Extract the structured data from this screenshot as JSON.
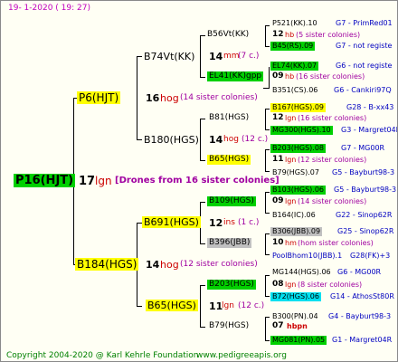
{
  "header": {
    "date": "19-   1-2020  ( 19:  27)"
  },
  "watermark": "",
  "footer": {
    "copyright": "Copyright 2004-2020 @ Karl Kehrle Foundation",
    "site": "www.pedigreeapis.org"
  },
  "root": {
    "label": "P16(HJT)",
    "number": "17",
    "type": "lgn",
    "drones": "[Drones from 16 sister colonies]"
  },
  "gen1": [
    {
      "label": "P6(HJT)",
      "number": "16",
      "type": "hog",
      "colonies": "(14 sister colonies)"
    },
    {
      "label": "B184(HGS)",
      "number": "14",
      "type": "hog",
      "colonies": "(12 sister colonies)"
    }
  ],
  "gen2": [
    {
      "label": "B74Vt(KK)",
      "number": "14",
      "type": "mm",
      "colonies": "(7 c.)"
    },
    {
      "label": "B180(HGS)",
      "number": "14",
      "type": "hog",
      "colonies": "(12 c.)"
    },
    {
      "label": "B691(HGS)",
      "number": "12",
      "type": "ins",
      "colonies": "(1 c.)"
    },
    {
      "label": "B65(HGS)",
      "number": "11",
      "type": "lgn",
      "colonies": "(12 c.)"
    }
  ],
  "gen3": [
    {
      "label": "B56Vt(KK)",
      "number": "12",
      "type": "hb",
      "colonies": "(5 sister colonies)"
    },
    {
      "label": "EL41(KK)gpp",
      "number": "09",
      "type": "hb",
      "colonies": "(16 sister colonies)"
    },
    {
      "label": "B81(HGS)",
      "number": "12",
      "type": "lgn",
      "colonies": "(16 sister colonies)"
    },
    {
      "label": "B65(HGS)",
      "number": "11",
      "type": "lgn",
      "colonies": "(12 sister colonies)"
    },
    {
      "label": "B109(HGS)",
      "number": "09",
      "type": "lgn",
      "colonies": "(14 sister colonies)"
    },
    {
      "label": "B396(JBB)",
      "number": "10",
      "type": "hm",
      "colonies": "(hom sister colonies)"
    },
    {
      "label": "B203(HGS)",
      "number": "08",
      "type": "lgn",
      "colonies": "(8 sister colonies)"
    },
    {
      "label": "B79(HGS)",
      "number": "07",
      "type": "hbpn",
      "colonies": ""
    }
  ],
  "gen4": [
    {
      "label": "P521(KK).10",
      "info": "G7 - PrimRed01"
    },
    {
      "label": "B45(RS).09",
      "info": "G7 - not registe"
    },
    {
      "label": "EL74(KK).07",
      "info": "G6 - not registe"
    },
    {
      "label": "B351(CS).06",
      "info": "G6 - Cankiri97Q"
    },
    {
      "label": "B167(HGS).09",
      "info": "G28 - B-xx43"
    },
    {
      "label": "MG300(HGS).10",
      "info": "G3 - Margret04R"
    },
    {
      "label": "B203(HGS).08",
      "info": "G7 - MG00R"
    },
    {
      "label": "B79(HGS).07",
      "info": "G5 - Bayburt98-3"
    },
    {
      "label": "B103(HGS).06",
      "info": "G5 - Bayburt98-3"
    },
    {
      "label": "B164(IC).06",
      "info": "G22 - Sinop62R"
    },
    {
      "label": "B306(JBB).09",
      "info": "G25 - Sinop62R"
    },
    {
      "label": "PoolBhom10(JBB).1",
      "info": "G28(FK)+3"
    },
    {
      "label": "MG144(HGS).06",
      "info": "G6 - MG00R"
    },
    {
      "label": "B72(HGS).06",
      "info": "G14 - AthosSt80R"
    },
    {
      "label": "B300(PN).04",
      "info": "G4 - Bayburt98-3"
    },
    {
      "label": "MG081(PN).05",
      "info": "G1 - Margret04R"
    }
  ],
  "colors": {
    "green": "#00d000",
    "yellow": "#ffff00",
    "cyan": "#00e0f0",
    "grey": "#c0c0c0",
    "number_red": "#cc0000",
    "type_purple": "#a000a0",
    "info_blue": "#0000c0"
  }
}
